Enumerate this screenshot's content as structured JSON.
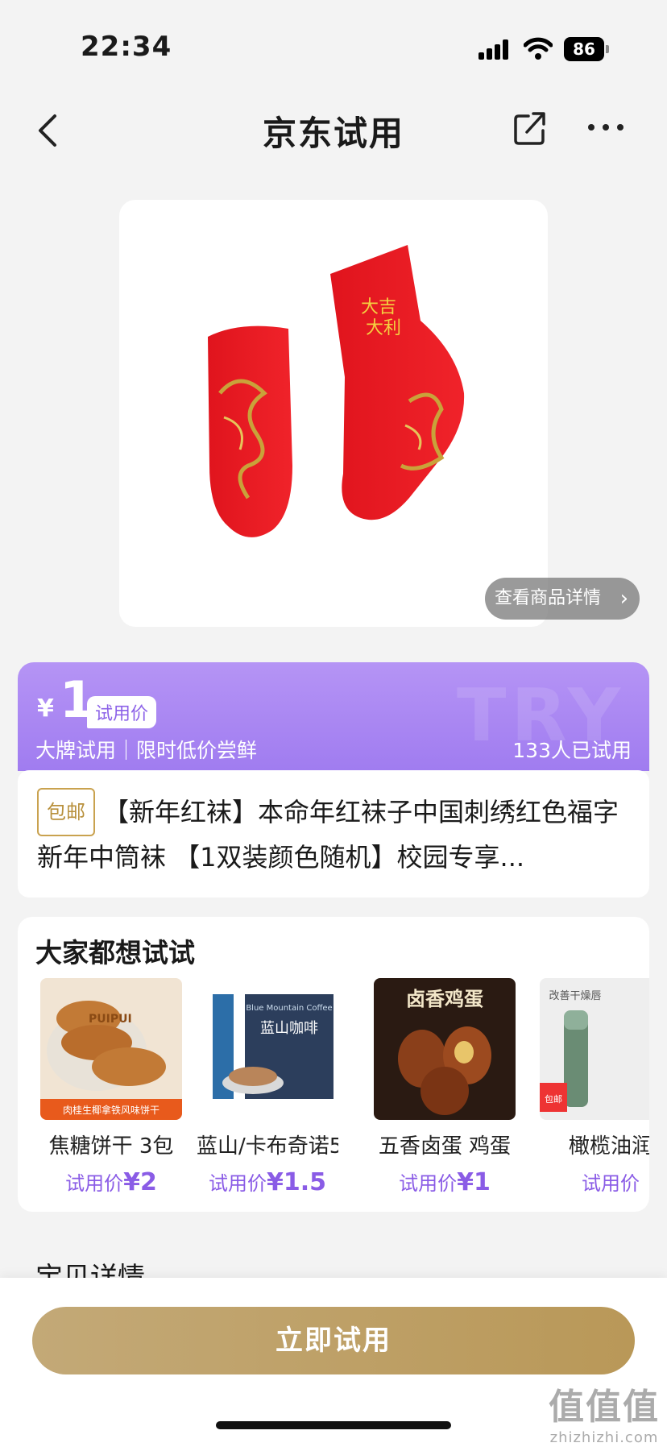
{
  "status_bar": {
    "time": "22:34",
    "battery": "86"
  },
  "nav": {
    "title": "京东试用"
  },
  "product": {
    "view_details_label": "查看商品详情"
  },
  "price": {
    "currency": "¥",
    "value": "1",
    "tag": "试用价",
    "subtitle": "大牌试用｜限时低价尝鲜",
    "tried_count": "133人已试用",
    "watermark": "TRY"
  },
  "title": {
    "badge": "包邮",
    "text": "【新年红袜】本命年红袜子中国刺绣红色福字新年中筒袜 【1双装颜色随机】校园专享..."
  },
  "recommend": {
    "heading": "大家都想试试",
    "items": [
      {
        "name": "焦糖饼干 3包",
        "price_label": "试用价",
        "price": "¥2",
        "img_brand": "PUIPUI",
        "img_caption": "肉桂生椰拿铁风味饼干"
      },
      {
        "name": "蓝山/卡布奇诺5",
        "price_label": "试用价",
        "price": "¥1.5",
        "img_brand": "Blue Mountain Coffee",
        "img_caption": "蓝山咖啡"
      },
      {
        "name": "五香卤蛋 鸡蛋",
        "price_label": "试用价",
        "price": "¥1",
        "img_caption": "卤香鸡蛋"
      },
      {
        "name": "橄榄油润",
        "price_label": "试用价",
        "price": "",
        "img_caption": "改善干燥唇",
        "img_badge": "包邮"
      }
    ]
  },
  "section_peek": "宝贝详情",
  "cta": {
    "label": "立即试用"
  },
  "watermark": {
    "main": "值值值",
    "sub": "zhizhizhi.com"
  },
  "colors": {
    "accent": "#a07cf0",
    "gold": "#bfa068",
    "price_text": "#8a5ce6"
  }
}
